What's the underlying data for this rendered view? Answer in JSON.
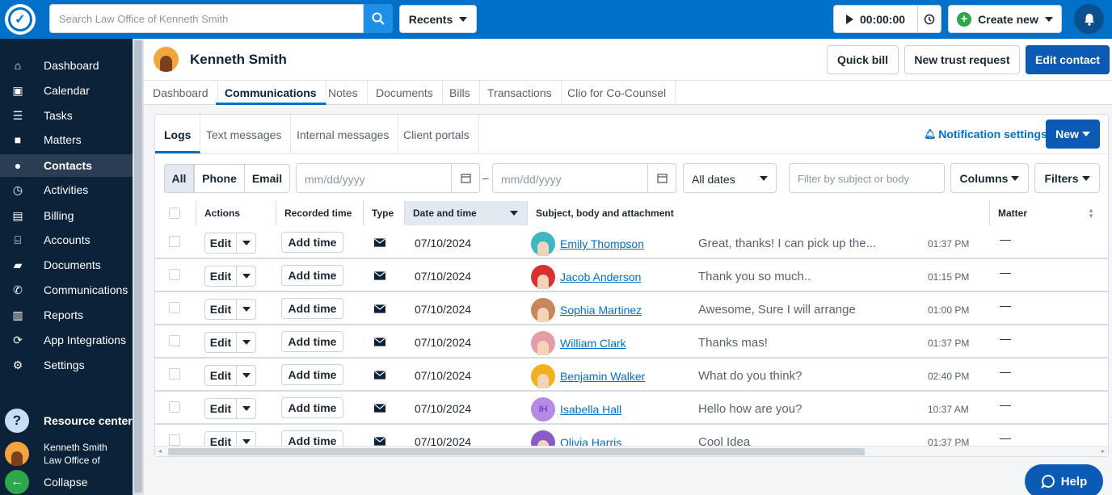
{
  "topbar": {
    "search_placeholder": "Search Law Office of Kenneth Smith",
    "recents": "Recents",
    "timer": "00:00:00",
    "create_new": "Create new"
  },
  "sidebar": {
    "items": [
      {
        "label": "Dashboard",
        "icon": "home-icon"
      },
      {
        "label": "Calendar",
        "icon": "calendar-icon"
      },
      {
        "label": "Tasks",
        "icon": "tasks-icon"
      },
      {
        "label": "Matters",
        "icon": "briefcase-icon"
      },
      {
        "label": "Contacts",
        "icon": "person-icon"
      },
      {
        "label": "Activities",
        "icon": "clock-icon"
      },
      {
        "label": "Billing",
        "icon": "money-icon"
      },
      {
        "label": "Accounts",
        "icon": "bank-icon"
      },
      {
        "label": "Documents",
        "icon": "folder-icon"
      },
      {
        "label": "Communications",
        "icon": "phone-icon"
      },
      {
        "label": "Reports",
        "icon": "chart-icon"
      },
      {
        "label": "App Integrations",
        "icon": "sync-icon"
      },
      {
        "label": "Settings",
        "icon": "gear-icon"
      }
    ],
    "active": "Contacts",
    "resource_center": "Resource center",
    "user_name": "Kenneth Smith",
    "user_org": "Law Office of",
    "collapse": "Collapse"
  },
  "header": {
    "contact_name": "Kenneth Smith",
    "quick_bill": "Quick bill",
    "new_trust_request": "New trust request",
    "edit_contact": "Edit contact"
  },
  "tabs": [
    "Dashboard",
    "Communications",
    "Notes",
    "Documents",
    "Bills",
    "Transactions",
    "Clio for Co-Counsel"
  ],
  "active_tab": "Communications",
  "subtabs": [
    "Logs",
    "Text messages",
    "Internal messages",
    "Client portals"
  ],
  "active_subtab": "Logs",
  "notification_settings": "Notification settings",
  "new_button": "New",
  "filters": {
    "seg": [
      "All",
      "Phone",
      "Email"
    ],
    "date_from_placeholder": "mm/dd/yyyy",
    "date_to_placeholder": "mm/dd/yyyy",
    "range_separator": "–",
    "all_dates": "All dates",
    "subject_placeholder": "Filter by subject or body",
    "columns": "Columns",
    "filters": "Filters"
  },
  "table": {
    "headers": [
      "Actions",
      "Recorded time",
      "Type",
      "Date and time",
      "Subject, body and attachment",
      "Matter"
    ],
    "edit_label": "Edit",
    "add_time_label": "Add time",
    "rows": [
      {
        "date": "07/10/2024",
        "name": "Emily Thompson",
        "subject": "Great, thanks! I can pick up the...",
        "time": "01:37 PM",
        "matter": "—"
      },
      {
        "date": "07/10/2024",
        "name": "Jacob Anderson",
        "subject": "Thank you so much..",
        "time": "01:15 PM",
        "matter": "—"
      },
      {
        "date": "07/10/2024",
        "name": "Sophia Martinez",
        "subject": "Awesome, Sure I will arrange",
        "time": "01:00 PM",
        "matter": "—"
      },
      {
        "date": "07/10/2024",
        "name": "William Clark",
        "subject": "Thanks mas!",
        "time": "01:37 PM",
        "matter": "—"
      },
      {
        "date": "07/10/2024",
        "name": "Benjamin Walker",
        "subject": "What do you think?",
        "time": "02:40 PM",
        "matter": "—"
      },
      {
        "date": "07/10/2024",
        "name": "Isabella Hall",
        "initials": "IH",
        "subject": "Hello how are you?",
        "time": "10:37 AM",
        "matter": "—"
      },
      {
        "date": "07/10/2024",
        "name": "Olivia Harris",
        "subject": "Cool Idea",
        "time": "01:37 PM",
        "matter": "—"
      }
    ]
  },
  "help": "Help",
  "colors": {
    "brand": "#0070c9",
    "sidebar": "#0b2239",
    "primary_button": "#0b5bb5",
    "green": "#2aa84a"
  }
}
